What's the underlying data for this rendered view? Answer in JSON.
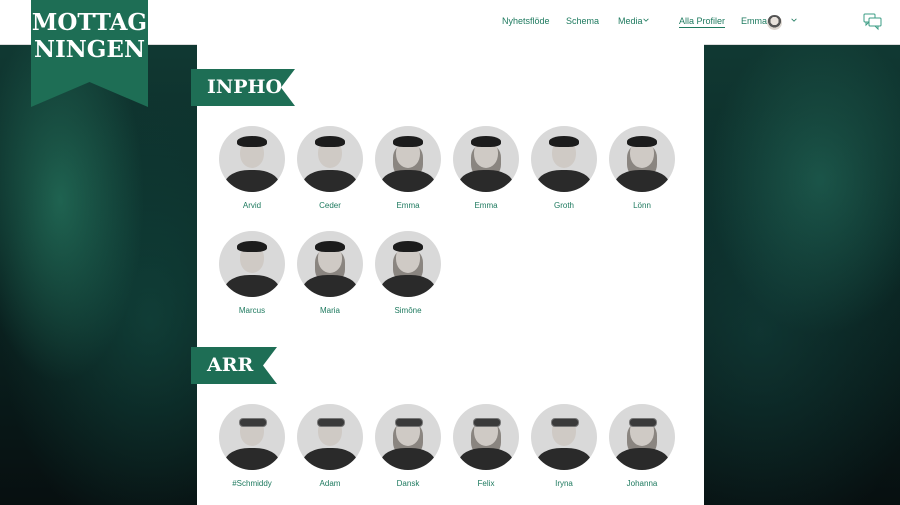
{
  "brand": {
    "logo_line1": "MOTTAG",
    "logo_line2": "NINGEN",
    "accent": "#1e6e55",
    "link_color": "#1e7a5f"
  },
  "nav": {
    "items": [
      "Nyhetsflöde",
      "Schema",
      "Media",
      "Alla Profiler"
    ],
    "active": "Alla Profiler",
    "user_name": "Emma"
  },
  "sections": [
    {
      "title": "INPHO",
      "profiles": [
        "Arvid",
        "Ceder",
        "Emma",
        "Emma",
        "Groth",
        "Lönn",
        "Marcus",
        "Maria",
        "Simône"
      ]
    },
    {
      "title": "ARR",
      "profiles": [
        "#Schmiddy",
        "Adam",
        "Dansk",
        "Felix",
        "Iryna",
        "Johanna"
      ]
    }
  ],
  "icons": {
    "chat": "chat-bubbles-icon",
    "chevron": "chevron-down-icon"
  }
}
